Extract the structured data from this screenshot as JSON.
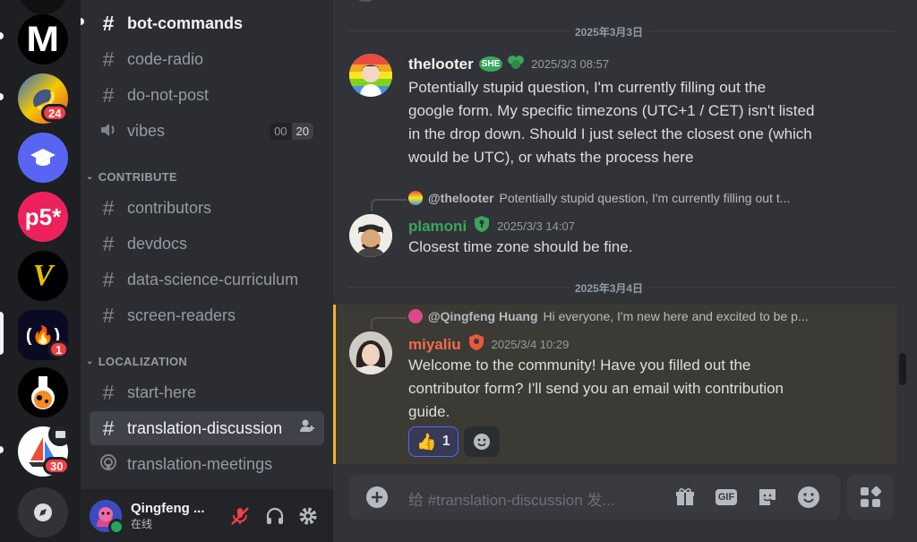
{
  "servers": [
    {
      "name": "server-partial-top"
    },
    {
      "name": "server-m-logo",
      "text": "M"
    },
    {
      "name": "server-python",
      "badge": "24"
    },
    {
      "name": "server-graduation"
    },
    {
      "name": "server-p5",
      "text": "p5*"
    },
    {
      "name": "server-v-logo",
      "text": "V"
    },
    {
      "name": "server-freecodecamp",
      "text": "(🔥)",
      "badge": "1"
    },
    {
      "name": "server-flask"
    },
    {
      "name": "server-sailboat",
      "badge": "30"
    },
    {
      "name": "server-discover"
    }
  ],
  "channels": {
    "top": [
      {
        "label": "bot-commands",
        "icon": "#"
      },
      {
        "label": "code-radio",
        "icon": "#"
      },
      {
        "label": "do-not-post",
        "icon": "#"
      },
      {
        "label": "vibes",
        "icon": "speaker",
        "time_a": "00",
        "time_b": "20"
      }
    ],
    "contribute_title": "CONTRIBUTE",
    "contribute": [
      {
        "label": "contributors"
      },
      {
        "label": "devdocs"
      },
      {
        "label": "data-science-curriculum"
      },
      {
        "label": "screen-readers"
      }
    ],
    "localization_title": "LOCALIZATION",
    "localization": [
      {
        "label": "start-here"
      },
      {
        "label": "translation-discussion"
      },
      {
        "label": "translation-meetings"
      }
    ]
  },
  "user": {
    "name": "Qingfeng ...",
    "status": "在线"
  },
  "chat": {
    "date1": "2025年3月3日",
    "date2": "2025年3月4日",
    "messages": [
      {
        "author": "thelooter",
        "tag": "SHE",
        "time": "2025/3/3 08:57",
        "author_color": "#f2f3f5",
        "lines": [
          "Potentially stupid question, I'm currently filling out the",
          "google form. My specific timezons (UTC+1 / CET) isn't listed",
          "in the drop down. Should I just select the closest one (which",
          "would be UTC), or whats the process here"
        ]
      },
      {
        "author": "plamoni",
        "time": "2025/3/3 14:07",
        "author_color": "#3ba55c",
        "reply_to": "@thelooter",
        "reply_text": "Potentially stupid question, I'm currently filling out t...",
        "lines": [
          "Closest time zone should be fine."
        ]
      },
      {
        "author": "miyaliu",
        "time": "2025/3/4 10:29",
        "author_color": "#f06b4e",
        "reply_to": "@Qingfeng Huang",
        "reply_text": "Hi everyone, I'm new here and excited to be p...",
        "lines": [
          "Welcome to the community! Have you filled out the",
          "contributor form? I'll send you an email with contribution",
          "guide."
        ],
        "reaction": {
          "emoji": "👍",
          "count": "1"
        }
      }
    ],
    "composer_placeholder": "给 #translation-discussion 发...",
    "gif_label": "GIF"
  },
  "colors": {
    "accent": "#5865f2",
    "highlight": "#f0b232",
    "online": "#23a55a"
  }
}
